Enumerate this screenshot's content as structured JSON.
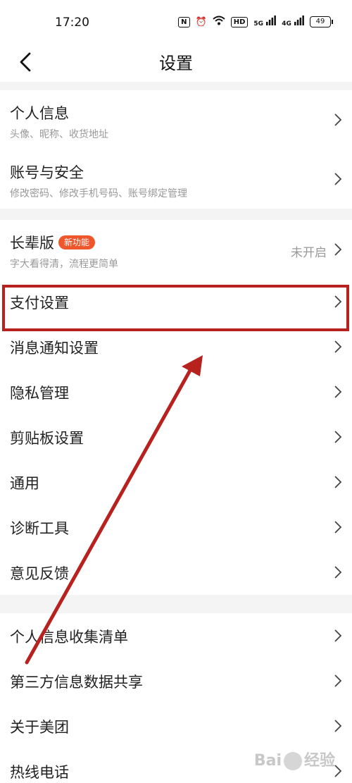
{
  "status_bar": {
    "time": "17:20",
    "nfc": "N",
    "hd": "HD",
    "net1": "5G",
    "net2": "4G",
    "battery": "49"
  },
  "header": {
    "title": "设置"
  },
  "groups": [
    {
      "items": [
        {
          "label": "个人信息",
          "sub": "头像、昵称、收货地址"
        },
        {
          "label": "账号与安全",
          "sub": "修改密码、修改手机号码、账号绑定管理"
        }
      ]
    },
    {
      "items": [
        {
          "label": "长辈版",
          "tag": "新功能",
          "sub": "字大看得清，流程更简单",
          "status": "未开启"
        },
        {
          "label": "支付设置"
        },
        {
          "label": "消息通知设置"
        },
        {
          "label": "隐私管理"
        },
        {
          "label": "剪贴板设置"
        },
        {
          "label": "通用"
        },
        {
          "label": "诊断工具"
        },
        {
          "label": "意见反馈"
        }
      ]
    },
    {
      "items": [
        {
          "label": "个人信息收集清单"
        },
        {
          "label": "第三方信息数据共享"
        },
        {
          "label": "关于美团"
        },
        {
          "label": "热线电话"
        }
      ]
    }
  ],
  "watermark": {
    "text1": "Bai",
    "text2": "经验"
  },
  "colors": {
    "annotation": "#b7211e",
    "tag": "#f0562b"
  }
}
